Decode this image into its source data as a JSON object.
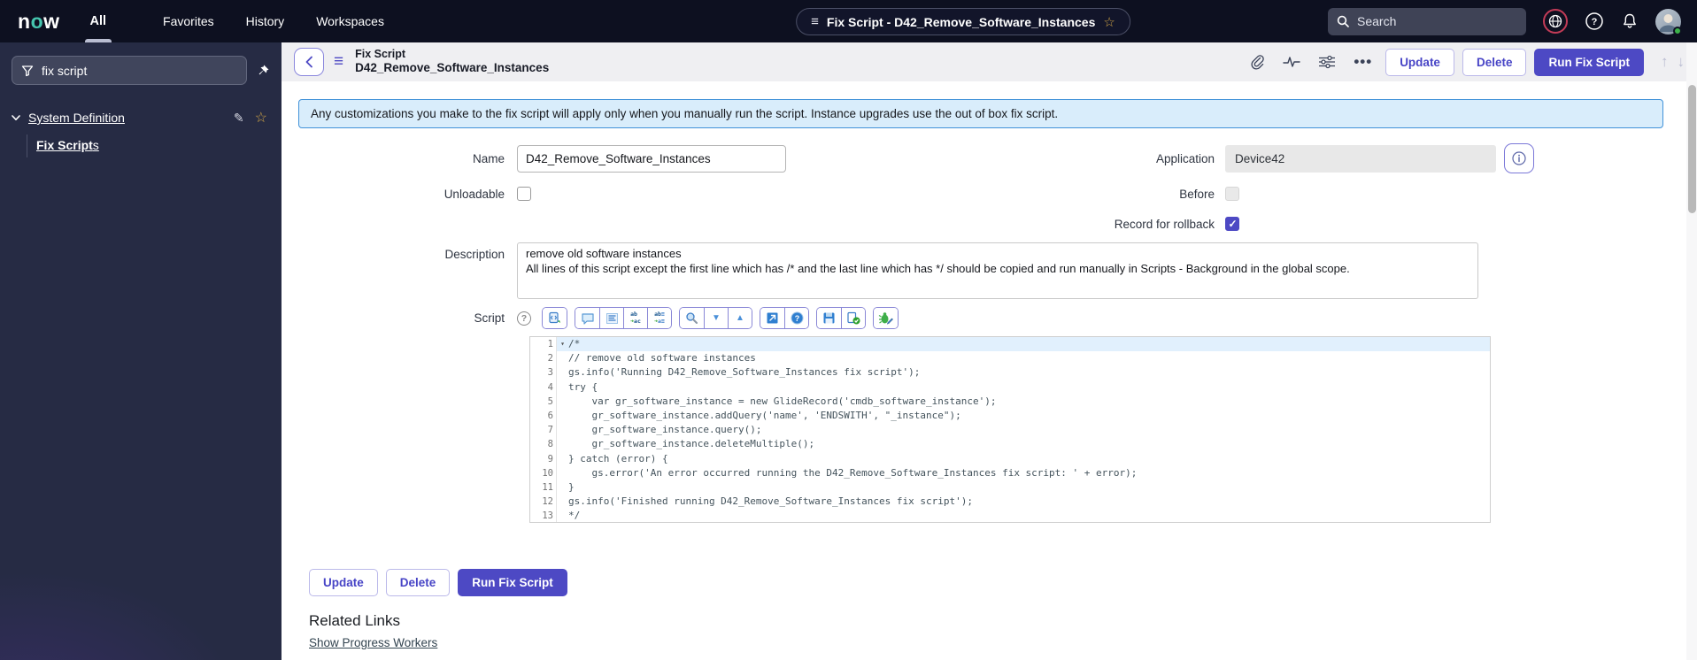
{
  "topbar": {
    "logo_n": "n",
    "logo_o": "o",
    "logo_w": "w",
    "all_tab": "All",
    "nav": {
      "favorites": "Favorites",
      "history": "History",
      "workspaces": "Workspaces"
    },
    "context_pill": "Fix Script - D42_Remove_Software_Instances",
    "search_placeholder": "Search"
  },
  "sidebar": {
    "filter_value": "fix script",
    "section_label": "System Definition",
    "item_label_match": "Fix Script",
    "item_label_suffix": "s"
  },
  "form_header": {
    "record_type": "Fix Script",
    "record_name": "D42_Remove_Software_Instances",
    "update_label": "Update",
    "delete_label": "Delete",
    "run_label": "Run Fix Script"
  },
  "banner": {
    "text": "Any customizations you make to the fix script will apply only when you manually run the script. Instance upgrades use the out of box fix script."
  },
  "form": {
    "name_label": "Name",
    "name_value": "D42_Remove_Software_Instances",
    "application_label": "Application",
    "application_value": "Device42",
    "unloadable_label": "Unloadable",
    "before_label": "Before",
    "rollback_label": "Record for rollback",
    "rollback_checked": "checked",
    "description_label": "Description",
    "description_value": "remove old software instances\nAll lines of this script except the first line which has /* and the last line which has */ should be copied and run manually in Scripts - Background in the global scope.",
    "script_label": "Script"
  },
  "editor": {
    "fold_marker": "▾",
    "line_numbers": [
      1,
      2,
      3,
      4,
      5,
      6,
      7,
      8,
      9,
      10,
      11,
      12,
      13
    ],
    "lines": [
      "/*",
      "// remove old software instances",
      "gs.info('Running D42_Remove_Software_Instances fix script');",
      "try {",
      "    var gr_software_instance = new GlideRecord('cmdb_software_instance');",
      "    gr_software_instance.addQuery('name', 'ENDSWITH', \"_instance\");",
      "    gr_software_instance.query();",
      "    gr_software_instance.deleteMultiple();",
      "} catch (error) {",
      "    gs.error('An error occurred running the D42_Remove_Software_Instances fix script: ' + error);",
      "}",
      "gs.info('Finished running D42_Remove_Software_Instances fix script');",
      "*/"
    ]
  },
  "footer": {
    "update_label": "Update",
    "delete_label": "Delete",
    "run_label": "Run Fix Script",
    "related_links_title": "Related Links",
    "progress_link": "Show Progress Workers"
  },
  "glyphs": {
    "menu": "≡",
    "star": "☆",
    "pencil": "✎",
    "ellipsis": "•••",
    "up_arrow": "↑",
    "down_arrow": "↓",
    "chev_down": "▼",
    "chev_up": "▲",
    "help": "?"
  },
  "colors": {
    "accent": "#4d49c4",
    "topbar": "#0d1020",
    "sidebar": "#262b44",
    "banner_bg": "#d9edfb",
    "banner_border": "#4192d9",
    "active_line": "#e1f0fd",
    "code_text": "#44535c",
    "globe_ring": "#c23b57"
  }
}
